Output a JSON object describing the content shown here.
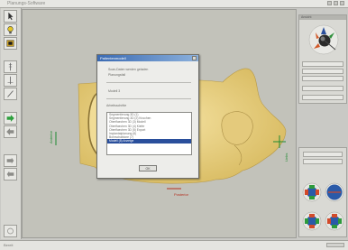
{
  "window": {
    "title": "Planungs-Software"
  },
  "dialog": {
    "title": "Patientenmodell",
    "info_lines": [
      "Scan-Daten werden geladen",
      "Planungsfall",
      "Modell 3"
    ],
    "list_header": "Arbeitsschritte",
    "items": [
      "Segmentierung 3D (1)",
      "Segmentierung 3D (2) Knochen",
      "Oberflaechen 3D (3) Modell",
      "Oberflaechen 3D (4) Kiefer",
      "Oberflaechen 3D (5) Export",
      "Implantatplanung (6)",
      "Bohrschablone (7)",
      "Modell (8) Anzeige"
    ],
    "selected_index": 7,
    "ok_label": "OK"
  },
  "viewport": {
    "axis_labels": [
      "Anterior",
      "Posterior",
      "Links"
    ]
  },
  "orientation_panel": {
    "title": "Ansicht"
  },
  "status": {
    "text": "Bereit"
  },
  "colors": {
    "viewport_bg": "#c2c2ba",
    "model_fill": "#ecd58a",
    "accent_green": "#1f8a32",
    "accent_red": "#b53222",
    "dialog_selection": "#2a4f9c"
  }
}
